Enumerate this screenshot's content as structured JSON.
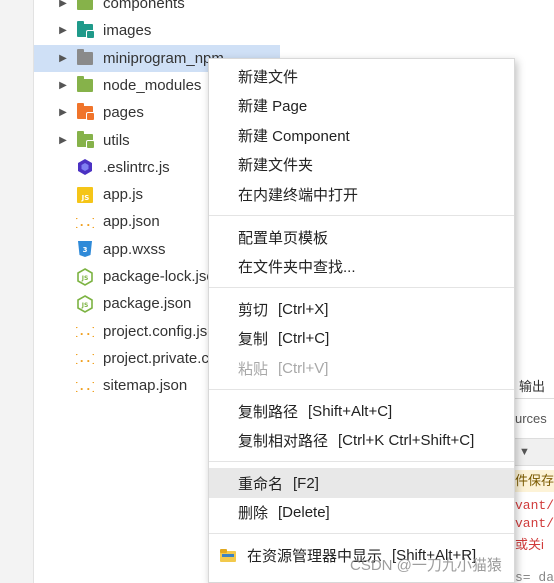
{
  "explorer": {
    "items": [
      {
        "label": "components",
        "kind": "folder",
        "color": "#86b24a",
        "badge": "",
        "expandable": true
      },
      {
        "label": "images",
        "kind": "folder",
        "color": "#1f9a8a",
        "badge": "▸",
        "expandable": true
      },
      {
        "label": "miniprogram_npm",
        "kind": "folder",
        "color": "#8a8a8a",
        "badge": "",
        "expandable": true,
        "selected": true
      },
      {
        "label": "node_modules",
        "kind": "folder",
        "color": "#86b24a",
        "badge": "",
        "expandable": true
      },
      {
        "label": "pages",
        "kind": "folder",
        "color": "#f0742b",
        "badge": "◉",
        "expandable": true
      },
      {
        "label": "utils",
        "kind": "folder",
        "color": "#86b24a",
        "badge": "✓",
        "expandable": true
      },
      {
        "label": ".eslintrc.js",
        "kind": "eslint"
      },
      {
        "label": "app.js",
        "kind": "js"
      },
      {
        "label": "app.json",
        "kind": "json"
      },
      {
        "label": "app.wxss",
        "kind": "css"
      },
      {
        "label": "package-lock.json",
        "kind": "node"
      },
      {
        "label": "package.json",
        "kind": "node"
      },
      {
        "label": "project.config.json",
        "kind": "json"
      },
      {
        "label": "project.private.config.json",
        "kind": "json"
      },
      {
        "label": "sitemap.json",
        "kind": "json"
      }
    ]
  },
  "context_menu": {
    "groups": [
      [
        {
          "label": "新建文件",
          "shortcut": ""
        },
        {
          "label": "新建 Page",
          "shortcut": ""
        },
        {
          "label": "新建 Component",
          "shortcut": ""
        },
        {
          "label": "新建文件夹",
          "shortcut": ""
        },
        {
          "label": "在内建终端中打开",
          "shortcut": ""
        }
      ],
      [
        {
          "label": "配置单页模板",
          "shortcut": ""
        },
        {
          "label": "在文件夹中查找...",
          "shortcut": ""
        }
      ],
      [
        {
          "label": "剪切",
          "shortcut": "[Ctrl+X]"
        },
        {
          "label": "复制",
          "shortcut": "[Ctrl+C]"
        },
        {
          "label": "粘贴",
          "shortcut": "[Ctrl+V]",
          "disabled": true
        }
      ],
      [
        {
          "label": "复制路径",
          "shortcut": "[Shift+Alt+C]"
        },
        {
          "label": "复制相对路径",
          "shortcut": "[Ctrl+K Ctrl+Shift+C]"
        }
      ],
      [
        {
          "label": "重命名",
          "shortcut": "[F2]",
          "hover": true
        },
        {
          "label": "删除",
          "shortcut": "[Delete]"
        }
      ],
      [
        {
          "label": "在资源管理器中显示",
          "shortcut": "[Shift+Alt+R]",
          "icon": "folder-icon"
        }
      ]
    ]
  },
  "right_panel": {
    "output_tab": "输出",
    "sources_tab": "urces",
    "dropdown": "▼",
    "line1": "件保存",
    "line2": "vant/u",
    "line3": "vant/",
    "line4": "或关i",
    "line5": "s= da"
  },
  "watermark": "CSDN @一刀九小猫猿",
  "colors": {
    "selection": "#cfe0f6",
    "menu_hover": "#e8e8e8",
    "error_text": "#d13b3b"
  }
}
